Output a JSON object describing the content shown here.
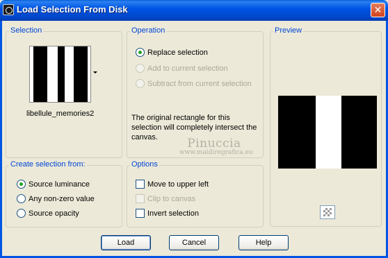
{
  "window": {
    "title": "Load Selection From Disk",
    "close_label": "✕"
  },
  "selection": {
    "label": "Selection",
    "name": "libellule_memories2"
  },
  "operation": {
    "label": "Operation",
    "options": [
      {
        "label": "Replace selection",
        "checked": true,
        "enabled": true
      },
      {
        "label": "Add to current selection",
        "checked": false,
        "enabled": false
      },
      {
        "label": "Subtract from current selection",
        "checked": false,
        "enabled": false
      }
    ],
    "note": "The original rectangle for this selection will completely intersect the canvas."
  },
  "watermark": {
    "name": "Pinuccia",
    "url": "www.maidiregrafica.eu"
  },
  "preview": {
    "label": "Preview"
  },
  "create": {
    "label": "Create selection from:",
    "options": [
      {
        "label": "Source luminance",
        "checked": true
      },
      {
        "label": "Any non-zero value",
        "checked": false
      },
      {
        "label": "Source opacity",
        "checked": false
      }
    ]
  },
  "options": {
    "label": "Options",
    "items": [
      {
        "label": "Move to upper left",
        "checked": false,
        "enabled": true
      },
      {
        "label": "Clip to canvas",
        "checked": false,
        "enabled": false
      },
      {
        "label": "Invert selection",
        "checked": false,
        "enabled": true
      }
    ]
  },
  "buttons": {
    "load": "Load",
    "cancel": "Cancel",
    "help": "Help"
  }
}
